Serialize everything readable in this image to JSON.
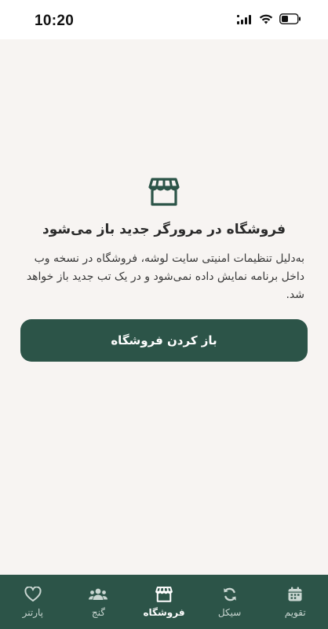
{
  "status_bar": {
    "time": "10:20",
    "icons": [
      "cellular-signal-icon",
      "wifi-icon",
      "battery-icon"
    ]
  },
  "main": {
    "icon": "storefront-icon",
    "title": "فروشگاه در مرورگر جدید باز می‌شود",
    "description": "به‌دلیل تنظیمات امنیتی سایت لوشه، فروشگاه در نسخه وب داخل برنامه نمایش داده نمی‌شود و در یک تب جدید باز خواهد شد.",
    "button_label": "باز کردن فروشگاه"
  },
  "bottom_nav": {
    "active_index": 2,
    "items": [
      {
        "label": "تقویم",
        "icon": "calendar-icon"
      },
      {
        "label": "سیکل",
        "icon": "cycle-icon"
      },
      {
        "label": "فروشگاه",
        "icon": "store-icon"
      },
      {
        "label": "گنج",
        "icon": "people-icon"
      },
      {
        "label": "پارتنر",
        "icon": "heart-icon"
      }
    ]
  },
  "colors": {
    "primary": "#2c5448",
    "background": "#f7f4f2",
    "nav_inactive_text": "#c9d6d1",
    "nav_active_text": "#ffffff"
  }
}
